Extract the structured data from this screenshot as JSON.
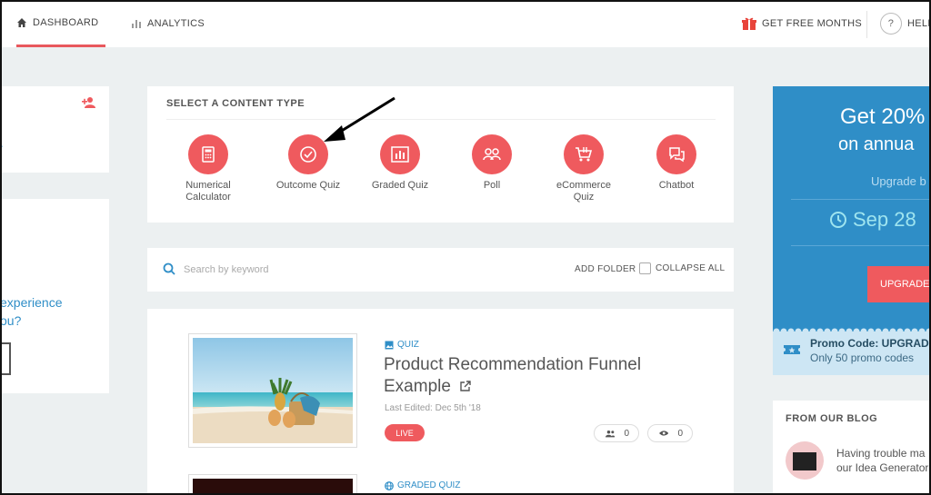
{
  "nav": {
    "dashboard": "DASHBOARD",
    "analytics": "ANALYTICS",
    "free_months": "GET FREE MONTHS",
    "help": "HELI",
    "help_symbol": "?"
  },
  "left": {
    "line1": " experience",
    "line2": "ou?"
  },
  "content_types": {
    "title": "SELECT A CONTENT TYPE",
    "items": [
      {
        "label": "Numerical Calculator",
        "icon": "calculator-icon"
      },
      {
        "label": "Outcome Quiz",
        "icon": "check-circle-icon"
      },
      {
        "label": "Graded Quiz",
        "icon": "bar-chart-icon"
      },
      {
        "label": "Poll",
        "icon": "people-icon"
      },
      {
        "label": "eCommerce Quiz",
        "icon": "cart-icon"
      },
      {
        "label": "Chatbot",
        "icon": "chat-icon"
      }
    ]
  },
  "search": {
    "placeholder": "Search by keyword",
    "add_folder": "ADD FOLDER",
    "collapse_all": "COLLAPSE ALL"
  },
  "quizzes": [
    {
      "type": "QUIZ",
      "title": "Product Recommendation Funnel Example",
      "last_edited": "Last Edited: Dec 5th '18",
      "status": "LIVE",
      "responses": "0",
      "views": "0"
    },
    {
      "type": "GRADED QUIZ"
    }
  ],
  "promo": {
    "headline": "Get 20%",
    "subline": "on annua",
    "upgrade_text": "Upgrade b",
    "date": "Sep 28",
    "button": "UPGRADE",
    "code_title": "Promo Code: UPGRAD",
    "code_sub": "Only 50 promo codes"
  },
  "blog": {
    "title": "FROM OUR BLOG",
    "line1": "Having trouble ma",
    "line2": "our Idea Generator"
  },
  "colors": {
    "accent": "#ef5a5e",
    "blue": "#2f8ec7",
    "background": "#ecf0f1"
  }
}
